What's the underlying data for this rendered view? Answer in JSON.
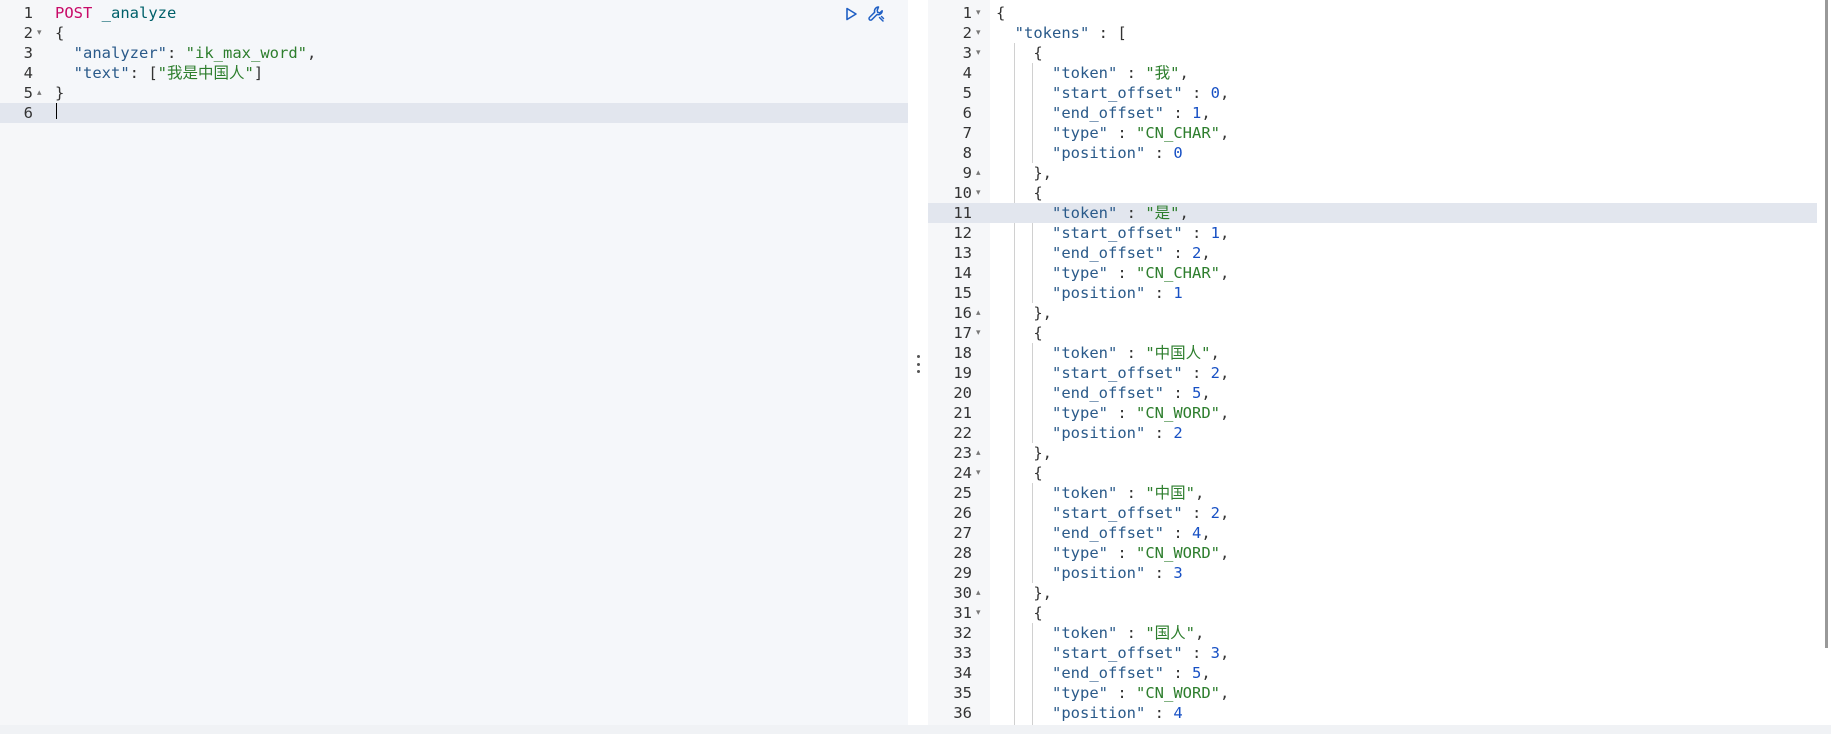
{
  "request_pane": {
    "lines": [
      {
        "n": "1",
        "fold": "",
        "tokens": [
          {
            "t": "method",
            "v": "POST"
          },
          {
            "t": "punc",
            "v": " "
          },
          {
            "t": "url",
            "v": "_analyze"
          }
        ]
      },
      {
        "n": "2",
        "fold": "▾",
        "tokens": [
          {
            "t": "punc",
            "v": "{"
          }
        ]
      },
      {
        "n": "3",
        "fold": "",
        "tokens": [
          {
            "t": "punc",
            "v": "  "
          },
          {
            "t": "key",
            "v": "\"analyzer\""
          },
          {
            "t": "punc",
            "v": ": "
          },
          {
            "t": "str",
            "v": "\"ik_max_word\""
          },
          {
            "t": "punc",
            "v": ","
          }
        ]
      },
      {
        "n": "4",
        "fold": "",
        "tokens": [
          {
            "t": "punc",
            "v": "  "
          },
          {
            "t": "key",
            "v": "\"text\""
          },
          {
            "t": "punc",
            "v": ": ["
          },
          {
            "t": "str",
            "v": "\"我是中国人\""
          },
          {
            "t": "punc",
            "v": "]"
          }
        ]
      },
      {
        "n": "5",
        "fold": "▴",
        "tokens": [
          {
            "t": "punc",
            "v": "}"
          }
        ]
      },
      {
        "n": "6",
        "fold": "",
        "active": true,
        "tokens": []
      }
    ],
    "run_icon": "play-icon",
    "settings_icon": "wrench-icon"
  },
  "response_pane": {
    "lines": [
      {
        "n": "1",
        "fold": "▾",
        "tokens": [
          {
            "t": "punc",
            "v": "{"
          }
        ]
      },
      {
        "n": "2",
        "fold": "▾",
        "tokens": [
          {
            "t": "punc",
            "v": "  "
          },
          {
            "t": "key",
            "v": "\"tokens\""
          },
          {
            "t": "punc",
            "v": " : ["
          }
        ]
      },
      {
        "n": "3",
        "fold": "▾",
        "tokens": [
          {
            "t": "punc",
            "v": "    {"
          }
        ]
      },
      {
        "n": "4",
        "fold": "",
        "tokens": [
          {
            "t": "punc",
            "v": "      "
          },
          {
            "t": "key",
            "v": "\"token\""
          },
          {
            "t": "punc",
            "v": " : "
          },
          {
            "t": "str",
            "v": "\"我\""
          },
          {
            "t": "punc",
            "v": ","
          }
        ]
      },
      {
        "n": "5",
        "fold": "",
        "tokens": [
          {
            "t": "punc",
            "v": "      "
          },
          {
            "t": "key",
            "v": "\"start_offset\""
          },
          {
            "t": "punc",
            "v": " : "
          },
          {
            "t": "num",
            "v": "0"
          },
          {
            "t": "punc",
            "v": ","
          }
        ]
      },
      {
        "n": "6",
        "fold": "",
        "tokens": [
          {
            "t": "punc",
            "v": "      "
          },
          {
            "t": "key",
            "v": "\"end_offset\""
          },
          {
            "t": "punc",
            "v": " : "
          },
          {
            "t": "num",
            "v": "1"
          },
          {
            "t": "punc",
            "v": ","
          }
        ]
      },
      {
        "n": "7",
        "fold": "",
        "tokens": [
          {
            "t": "punc",
            "v": "      "
          },
          {
            "t": "key",
            "v": "\"type\""
          },
          {
            "t": "punc",
            "v": " : "
          },
          {
            "t": "str",
            "v": "\"CN_CHAR\""
          },
          {
            "t": "punc",
            "v": ","
          }
        ]
      },
      {
        "n": "8",
        "fold": "",
        "tokens": [
          {
            "t": "punc",
            "v": "      "
          },
          {
            "t": "key",
            "v": "\"position\""
          },
          {
            "t": "punc",
            "v": " : "
          },
          {
            "t": "num",
            "v": "0"
          }
        ]
      },
      {
        "n": "9",
        "fold": "▴",
        "tokens": [
          {
            "t": "punc",
            "v": "    },"
          }
        ]
      },
      {
        "n": "10",
        "fold": "▾",
        "tokens": [
          {
            "t": "punc",
            "v": "    {"
          }
        ]
      },
      {
        "n": "11",
        "fold": "",
        "active": true,
        "tokens": [
          {
            "t": "punc",
            "v": "      "
          },
          {
            "t": "key",
            "v": "\"token\""
          },
          {
            "t": "punc",
            "v": " : "
          },
          {
            "t": "str",
            "v": "\"是\""
          },
          {
            "t": "punc",
            "v": ","
          }
        ]
      },
      {
        "n": "12",
        "fold": "",
        "tokens": [
          {
            "t": "punc",
            "v": "      "
          },
          {
            "t": "key",
            "v": "\"start_offset\""
          },
          {
            "t": "punc",
            "v": " : "
          },
          {
            "t": "num",
            "v": "1"
          },
          {
            "t": "punc",
            "v": ","
          }
        ]
      },
      {
        "n": "13",
        "fold": "",
        "tokens": [
          {
            "t": "punc",
            "v": "      "
          },
          {
            "t": "key",
            "v": "\"end_offset\""
          },
          {
            "t": "punc",
            "v": " : "
          },
          {
            "t": "num",
            "v": "2"
          },
          {
            "t": "punc",
            "v": ","
          }
        ]
      },
      {
        "n": "14",
        "fold": "",
        "tokens": [
          {
            "t": "punc",
            "v": "      "
          },
          {
            "t": "key",
            "v": "\"type\""
          },
          {
            "t": "punc",
            "v": " : "
          },
          {
            "t": "str",
            "v": "\"CN_CHAR\""
          },
          {
            "t": "punc",
            "v": ","
          }
        ]
      },
      {
        "n": "15",
        "fold": "",
        "tokens": [
          {
            "t": "punc",
            "v": "      "
          },
          {
            "t": "key",
            "v": "\"position\""
          },
          {
            "t": "punc",
            "v": " : "
          },
          {
            "t": "num",
            "v": "1"
          }
        ]
      },
      {
        "n": "16",
        "fold": "▴",
        "tokens": [
          {
            "t": "punc",
            "v": "    },"
          }
        ]
      },
      {
        "n": "17",
        "fold": "▾",
        "tokens": [
          {
            "t": "punc",
            "v": "    {"
          }
        ]
      },
      {
        "n": "18",
        "fold": "",
        "tokens": [
          {
            "t": "punc",
            "v": "      "
          },
          {
            "t": "key",
            "v": "\"token\""
          },
          {
            "t": "punc",
            "v": " : "
          },
          {
            "t": "str",
            "v": "\"中国人\""
          },
          {
            "t": "punc",
            "v": ","
          }
        ]
      },
      {
        "n": "19",
        "fold": "",
        "tokens": [
          {
            "t": "punc",
            "v": "      "
          },
          {
            "t": "key",
            "v": "\"start_offset\""
          },
          {
            "t": "punc",
            "v": " : "
          },
          {
            "t": "num",
            "v": "2"
          },
          {
            "t": "punc",
            "v": ","
          }
        ]
      },
      {
        "n": "20",
        "fold": "",
        "tokens": [
          {
            "t": "punc",
            "v": "      "
          },
          {
            "t": "key",
            "v": "\"end_offset\""
          },
          {
            "t": "punc",
            "v": " : "
          },
          {
            "t": "num",
            "v": "5"
          },
          {
            "t": "punc",
            "v": ","
          }
        ]
      },
      {
        "n": "21",
        "fold": "",
        "tokens": [
          {
            "t": "punc",
            "v": "      "
          },
          {
            "t": "key",
            "v": "\"type\""
          },
          {
            "t": "punc",
            "v": " : "
          },
          {
            "t": "str",
            "v": "\"CN_WORD\""
          },
          {
            "t": "punc",
            "v": ","
          }
        ]
      },
      {
        "n": "22",
        "fold": "",
        "tokens": [
          {
            "t": "punc",
            "v": "      "
          },
          {
            "t": "key",
            "v": "\"position\""
          },
          {
            "t": "punc",
            "v": " : "
          },
          {
            "t": "num",
            "v": "2"
          }
        ]
      },
      {
        "n": "23",
        "fold": "▴",
        "tokens": [
          {
            "t": "punc",
            "v": "    },"
          }
        ]
      },
      {
        "n": "24",
        "fold": "▾",
        "tokens": [
          {
            "t": "punc",
            "v": "    {"
          }
        ]
      },
      {
        "n": "25",
        "fold": "",
        "tokens": [
          {
            "t": "punc",
            "v": "      "
          },
          {
            "t": "key",
            "v": "\"token\""
          },
          {
            "t": "punc",
            "v": " : "
          },
          {
            "t": "str",
            "v": "\"中国\""
          },
          {
            "t": "punc",
            "v": ","
          }
        ]
      },
      {
        "n": "26",
        "fold": "",
        "tokens": [
          {
            "t": "punc",
            "v": "      "
          },
          {
            "t": "key",
            "v": "\"start_offset\""
          },
          {
            "t": "punc",
            "v": " : "
          },
          {
            "t": "num",
            "v": "2"
          },
          {
            "t": "punc",
            "v": ","
          }
        ]
      },
      {
        "n": "27",
        "fold": "",
        "tokens": [
          {
            "t": "punc",
            "v": "      "
          },
          {
            "t": "key",
            "v": "\"end_offset\""
          },
          {
            "t": "punc",
            "v": " : "
          },
          {
            "t": "num",
            "v": "4"
          },
          {
            "t": "punc",
            "v": ","
          }
        ]
      },
      {
        "n": "28",
        "fold": "",
        "tokens": [
          {
            "t": "punc",
            "v": "      "
          },
          {
            "t": "key",
            "v": "\"type\""
          },
          {
            "t": "punc",
            "v": " : "
          },
          {
            "t": "str",
            "v": "\"CN_WORD\""
          },
          {
            "t": "punc",
            "v": ","
          }
        ]
      },
      {
        "n": "29",
        "fold": "",
        "tokens": [
          {
            "t": "punc",
            "v": "      "
          },
          {
            "t": "key",
            "v": "\"position\""
          },
          {
            "t": "punc",
            "v": " : "
          },
          {
            "t": "num",
            "v": "3"
          }
        ]
      },
      {
        "n": "30",
        "fold": "▴",
        "tokens": [
          {
            "t": "punc",
            "v": "    },"
          }
        ]
      },
      {
        "n": "31",
        "fold": "▾",
        "tokens": [
          {
            "t": "punc",
            "v": "    {"
          }
        ]
      },
      {
        "n": "32",
        "fold": "",
        "tokens": [
          {
            "t": "punc",
            "v": "      "
          },
          {
            "t": "key",
            "v": "\"token\""
          },
          {
            "t": "punc",
            "v": " : "
          },
          {
            "t": "str",
            "v": "\"国人\""
          },
          {
            "t": "punc",
            "v": ","
          }
        ]
      },
      {
        "n": "33",
        "fold": "",
        "tokens": [
          {
            "t": "punc",
            "v": "      "
          },
          {
            "t": "key",
            "v": "\"start_offset\""
          },
          {
            "t": "punc",
            "v": " : "
          },
          {
            "t": "num",
            "v": "3"
          },
          {
            "t": "punc",
            "v": ","
          }
        ]
      },
      {
        "n": "34",
        "fold": "",
        "tokens": [
          {
            "t": "punc",
            "v": "      "
          },
          {
            "t": "key",
            "v": "\"end_offset\""
          },
          {
            "t": "punc",
            "v": " : "
          },
          {
            "t": "num",
            "v": "5"
          },
          {
            "t": "punc",
            "v": ","
          }
        ]
      },
      {
        "n": "35",
        "fold": "",
        "tokens": [
          {
            "t": "punc",
            "v": "      "
          },
          {
            "t": "key",
            "v": "\"type\""
          },
          {
            "t": "punc",
            "v": " : "
          },
          {
            "t": "str",
            "v": "\"CN_WORD\""
          },
          {
            "t": "punc",
            "v": ","
          }
        ]
      },
      {
        "n": "36",
        "fold": "",
        "tokens": [
          {
            "t": "punc",
            "v": "      "
          },
          {
            "t": "key",
            "v": "\"position\""
          },
          {
            "t": "punc",
            "v": " : "
          },
          {
            "t": "num",
            "v": "4"
          }
        ]
      }
    ]
  },
  "resizer_icon": "vertical-dots-icon"
}
